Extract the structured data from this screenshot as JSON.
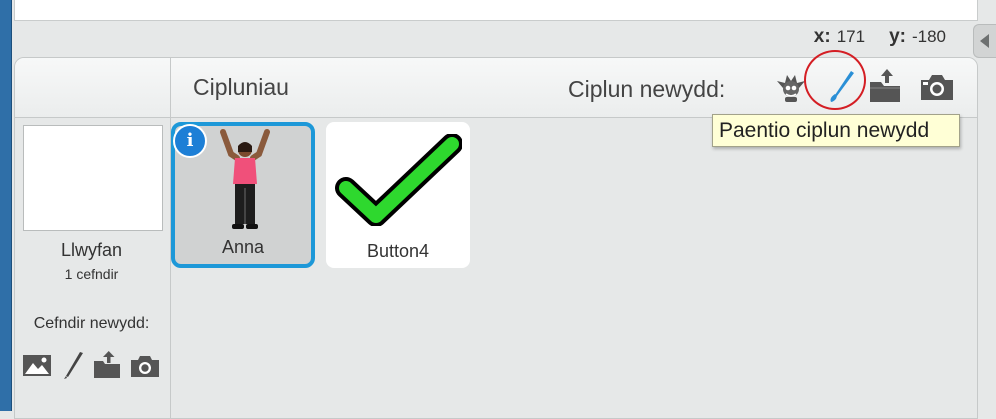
{
  "coords": {
    "x_label": "x:",
    "x_value": "171",
    "y_label": "y:",
    "y_value": "-180"
  },
  "sprites": {
    "title": "Cipluniau",
    "new_sprite_label": "Ciplun newydd:",
    "tooltip": "Paentio ciplun newydd",
    "items": [
      {
        "name": "Anna",
        "selected": true,
        "info_badge": "i"
      },
      {
        "name": "Button4",
        "selected": false
      }
    ]
  },
  "stage": {
    "name": "Llwyfan",
    "backdrop_count": "1 cefndir",
    "new_backdrop_label": "Cefndir newydd:"
  },
  "icons": {
    "new_sprite": [
      "sprite-library-icon",
      "paint-brush-icon",
      "upload-icon",
      "camera-icon"
    ],
    "new_backdrop": [
      "image-library-icon",
      "paint-pen-icon",
      "upload-icon",
      "camera-icon"
    ]
  },
  "colors": {
    "selection": "#1d98d8",
    "highlight": "#d41e24",
    "tooltip_bg": "#ffffd6"
  }
}
